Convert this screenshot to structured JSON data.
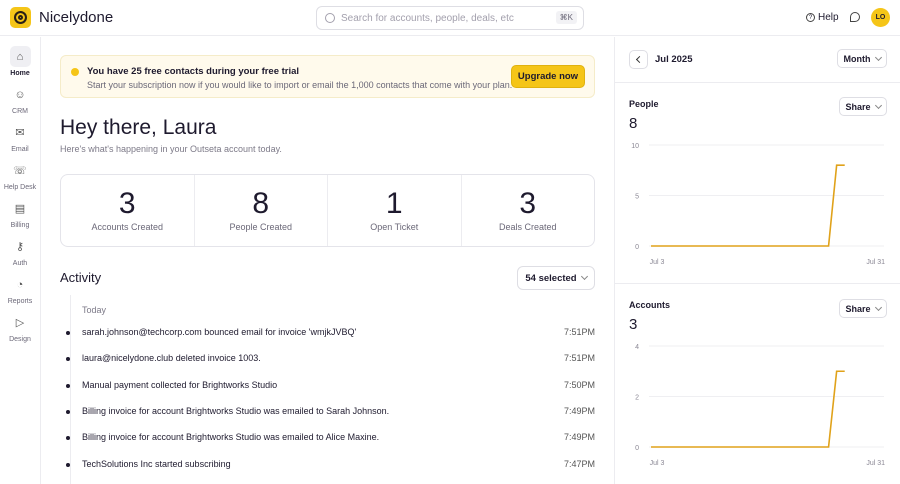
{
  "header": {
    "brand": "Nicelydone",
    "search_placeholder": "Search for accounts, people, deals, etc",
    "search_shortcut": "⌘K",
    "help": "Help",
    "avatar": "LO"
  },
  "sidebar": {
    "items": [
      {
        "label": "Home",
        "icon": "home-icon",
        "glyph": "⌂"
      },
      {
        "label": "CRM",
        "icon": "user-circle-icon",
        "glyph": "☺"
      },
      {
        "label": "Email",
        "icon": "mail-icon",
        "glyph": "✉"
      },
      {
        "label": "Help Desk",
        "icon": "chat-bubbles-icon",
        "glyph": "☏"
      },
      {
        "label": "Billing",
        "icon": "wallet-icon",
        "glyph": "▤"
      },
      {
        "label": "Auth",
        "icon": "key-icon",
        "glyph": "⚷"
      },
      {
        "label": "Reports",
        "icon": "chart-circle-icon",
        "glyph": "◔"
      },
      {
        "label": "Design",
        "icon": "cursor-icon",
        "glyph": "▷"
      }
    ]
  },
  "banner": {
    "title": "You have 25 free contacts during your free trial",
    "text": "Start your subscription now if you would like to import or email the 1,000 contacts that come with your plan.",
    "button": "Upgrade now"
  },
  "greeting": {
    "title": "Hey there, Laura",
    "subtitle": "Here's what's happening in your Outseta account today."
  },
  "stats": [
    {
      "value": "3",
      "label": "Accounts Created"
    },
    {
      "value": "8",
      "label": "People Created"
    },
    {
      "value": "1",
      "label": "Open Ticket"
    },
    {
      "value": "3",
      "label": "Deals Created"
    }
  ],
  "activity": {
    "title": "Activity",
    "filter": "54 selected",
    "group": "Today",
    "items": [
      {
        "text": "sarah.johnson@techcorp.com bounced email for invoice 'wmjkJVBQ'",
        "time": "7:51PM"
      },
      {
        "text": "laura@nicelydone.club deleted invoice 1003.",
        "time": "7:51PM"
      },
      {
        "text": "Manual payment collected for Brightworks Studio",
        "time": "7:50PM"
      },
      {
        "text": "Billing invoice for account Brightworks Studio was emailed to Sarah Johnson.",
        "time": "7:49PM"
      },
      {
        "text": "Billing invoice for account Brightworks Studio was emailed to Alice Maxine.",
        "time": "7:49PM"
      },
      {
        "text": "TechSolutions Inc started subscribing",
        "time": "7:47PM"
      }
    ]
  },
  "panel": {
    "period": "Jul 2025",
    "granularity": "Month",
    "share": "Share"
  },
  "chart_data": [
    {
      "type": "line",
      "title": "People",
      "total": "8",
      "color": "#e0a21a",
      "yticks": [
        "0",
        "5",
        "10"
      ],
      "ylim": [
        0,
        10
      ],
      "xlabels": [
        "Jul 3",
        "Jul 31"
      ],
      "xlim": [
        3,
        31
      ],
      "x": [
        3,
        25,
        26,
        27
      ],
      "values": [
        0,
        0,
        8,
        8
      ]
    },
    {
      "type": "line",
      "title": "Accounts",
      "total": "3",
      "color": "#e0a21a",
      "yticks": [
        "0",
        "2",
        "4"
      ],
      "ylim": [
        0,
        4
      ],
      "xlabels": [
        "Jul 3",
        "Jul 31"
      ],
      "xlim": [
        3,
        31
      ],
      "x": [
        3,
        25,
        26,
        27
      ],
      "values": [
        0,
        0,
        3,
        3
      ]
    }
  ]
}
